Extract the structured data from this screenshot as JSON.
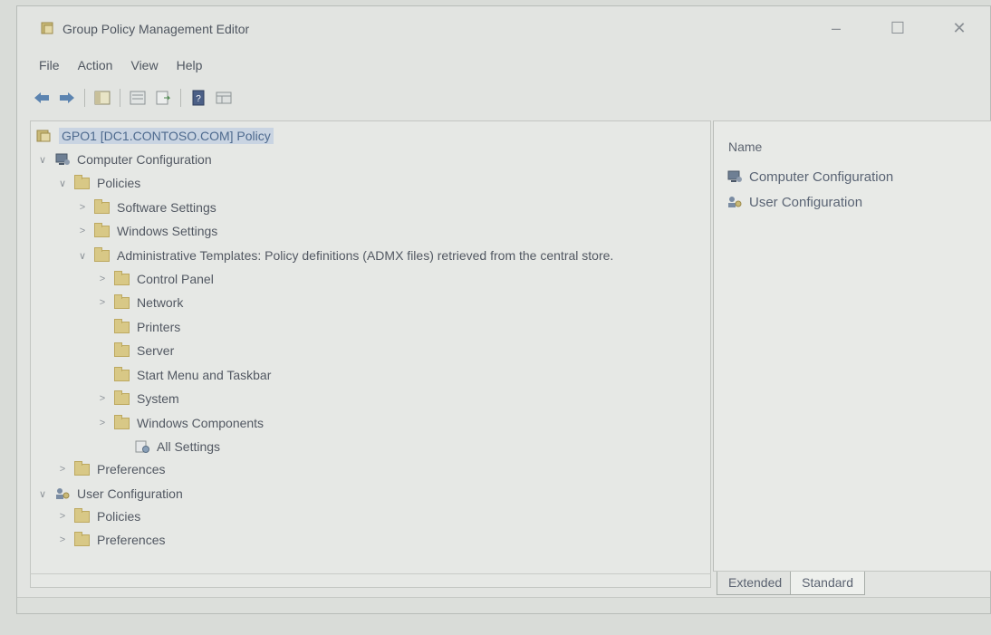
{
  "window": {
    "title": "Group Policy Management Editor",
    "controls": {
      "minimize": "–",
      "maximize": "☐",
      "close": "✕"
    }
  },
  "menu": [
    "File",
    "Action",
    "View",
    "Help"
  ],
  "toolbar_icons": [
    "back-arrow-icon",
    "forward-arrow-icon",
    "show-hide-tree-icon",
    "properties-icon",
    "export-list-icon",
    "help-icon",
    "view-icon"
  ],
  "tree": {
    "root": "GPO1 [DC1.CONTOSO.COM] Policy",
    "items": [
      {
        "label": "Computer Configuration"
      },
      {
        "label": "Policies"
      },
      {
        "label": "Software Settings"
      },
      {
        "label": "Windows Settings"
      },
      {
        "label": "Administrative Templates: Policy definitions (ADMX files) retrieved from the central store."
      },
      {
        "label": "Control Panel"
      },
      {
        "label": "Network"
      },
      {
        "label": "Printers"
      },
      {
        "label": "Server"
      },
      {
        "label": "Start Menu and Taskbar"
      },
      {
        "label": "System"
      },
      {
        "label": "Windows Components"
      },
      {
        "label": "All Settings"
      },
      {
        "label": "Preferences"
      },
      {
        "label": "User Configuration"
      },
      {
        "label": "Policies"
      },
      {
        "label": "Preferences"
      }
    ]
  },
  "details": {
    "column": "Name",
    "items": [
      "Computer Configuration",
      "User Configuration"
    ]
  },
  "tabs": [
    "Extended",
    "Standard"
  ],
  "colors": {
    "selection": "#c9d4e2",
    "folder": "#d8c886"
  }
}
